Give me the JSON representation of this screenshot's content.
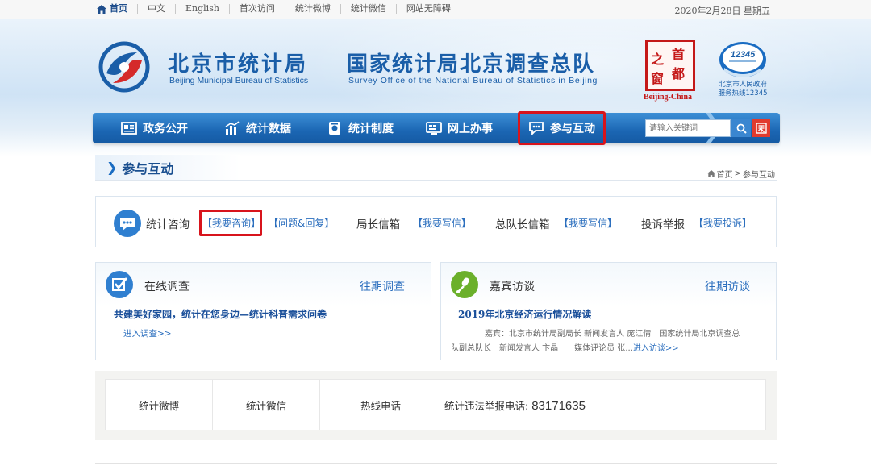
{
  "topbar": {
    "links": [
      "首页",
      "中文",
      "English",
      "首次访问",
      "统计微博",
      "统计微信",
      "网站无障碍"
    ],
    "date": "2020年2月28日 星期五"
  },
  "header": {
    "org1_cn": "北京市统计局",
    "org1_en": "Beijing Municipal Bureau of Statistics",
    "org2_cn": "国家统计局北京调查总队",
    "org2_en": "Survey Office of the National Bureau of Statistics in Beijing",
    "seal_chars": [
      "首",
      "都",
      "之",
      "窗"
    ],
    "seal_en": "Beijing-China",
    "hotline_number": "12345",
    "hotline_text": [
      "北京市人民政府",
      "服务热线12345"
    ]
  },
  "nav": {
    "items": [
      "政务公开",
      "统计数据",
      "统计制度",
      "网上办事",
      "参与互动"
    ],
    "active_index": 4,
    "search_placeholder": "请输入关键词",
    "accent": "#1b66b3",
    "highlight": "#d8141c"
  },
  "section": {
    "title": "参与互动",
    "breadcrumb": [
      "首页",
      "参与互动"
    ]
  },
  "interaction": [
    {
      "label": "统计咨询",
      "links": [
        "【我要咨询】",
        "【问题&回复】"
      ]
    },
    {
      "label": "局长信箱",
      "links": [
        "【我要写信】"
      ]
    },
    {
      "label": "总队长信箱",
      "links": [
        "【我要写信】"
      ]
    },
    {
      "label": "投诉举报",
      "links": [
        "【我要投诉】"
      ]
    }
  ],
  "survey": {
    "title": "在线调查",
    "more": "往期调查",
    "headline": "共建美好家园，统计在您身边—统计科普需求问卷",
    "go": "进入调查>>"
  },
  "interview": {
    "title": "嘉宾访谈",
    "more": "往期访谈",
    "headline": "2019年北京经济运行情况解读",
    "desc_line1": "嘉宾：北京市统计局副局长 新闻发言人 庞江倩　国家统计局北京调查总",
    "desc_line2": "队副总队长　新闻发言人 卞晶　　媒体评论员 张...",
    "go": "进入访谈>>"
  },
  "footer": {
    "cells": [
      "统计微博",
      "统计微信",
      "热线电话"
    ],
    "tel_label": "统计违法举报电话:",
    "tel_number": "83171635"
  }
}
